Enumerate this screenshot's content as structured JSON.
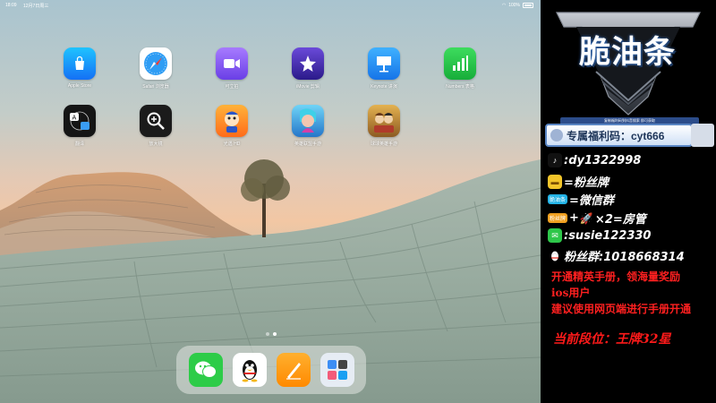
{
  "statusbar": {
    "time": "18:09",
    "date": "12月7日周三",
    "battery": "100%"
  },
  "apps": [
    {
      "name": "app-store",
      "label": "Apple Store",
      "bg": "#1ea0ff"
    },
    {
      "name": "safari",
      "label": "Safari 浏览器",
      "bg": "#ffffff"
    },
    {
      "name": "zoom",
      "label": "可立拍",
      "bg": "#8a5cf6"
    },
    {
      "name": "imovie",
      "label": "iMovie 剪辑",
      "bg": "#4b2fb5"
    },
    {
      "name": "keynote",
      "label": "Keynote 讲演",
      "bg": "#1f8ef1"
    },
    {
      "name": "numbers",
      "label": "Numbers 表格",
      "bg": "#25c445"
    },
    {
      "name": "translate",
      "label": "翻译",
      "bg": "#1a1a1a"
    },
    {
      "name": "magnifier",
      "label": "放大镜",
      "bg": "#1c1c1c"
    },
    {
      "name": "game1",
      "label": "光遇 HD",
      "bg": "#ff8b1f"
    },
    {
      "name": "game2",
      "label": "英雄联盟手游",
      "bg": "#2a9bd8"
    },
    {
      "name": "game3",
      "label": "球球英雄手游",
      "bg": "#c8902f"
    }
  ],
  "dock": [
    {
      "name": "wechat",
      "bg": "#2ed34a"
    },
    {
      "name": "qq",
      "bg": "#ffffff"
    },
    {
      "name": "pages",
      "bg": "#ff9b18"
    },
    {
      "name": "folder",
      "bg": "#e6ecf4"
    }
  ],
  "panel": {
    "logo": "脆油条",
    "code_small": "复制福利码到抖音搜索 即可获取",
    "code": "专属福利码：cyt666",
    "rows": [
      {
        "name": "douyin",
        "text": ":dy1322998",
        "color": "#111111"
      },
      {
        "name": "fans-badge",
        "text": "=粉丝牌",
        "color": "#f3c52a"
      },
      {
        "name": "wechat-group",
        "tag": "脆油条",
        "text": "=微信群",
        "color": "#23b3e6"
      },
      {
        "name": "admin",
        "tag": "粉丝牌",
        "text": "×2=房管",
        "color": "#f0a020"
      },
      {
        "name": "wechat-id",
        "text": ":susie122330",
        "color": "#2ec74a"
      },
      {
        "name": "fans-group",
        "text": "粉丝群:1018668314",
        "color": "#ffffff"
      }
    ],
    "notice_1": "开通精英手册，领海量奖励",
    "notice_2": "ios用户",
    "notice_3": "建议使用网页端进行手册开通",
    "rank": "当前段位：王牌32星"
  }
}
